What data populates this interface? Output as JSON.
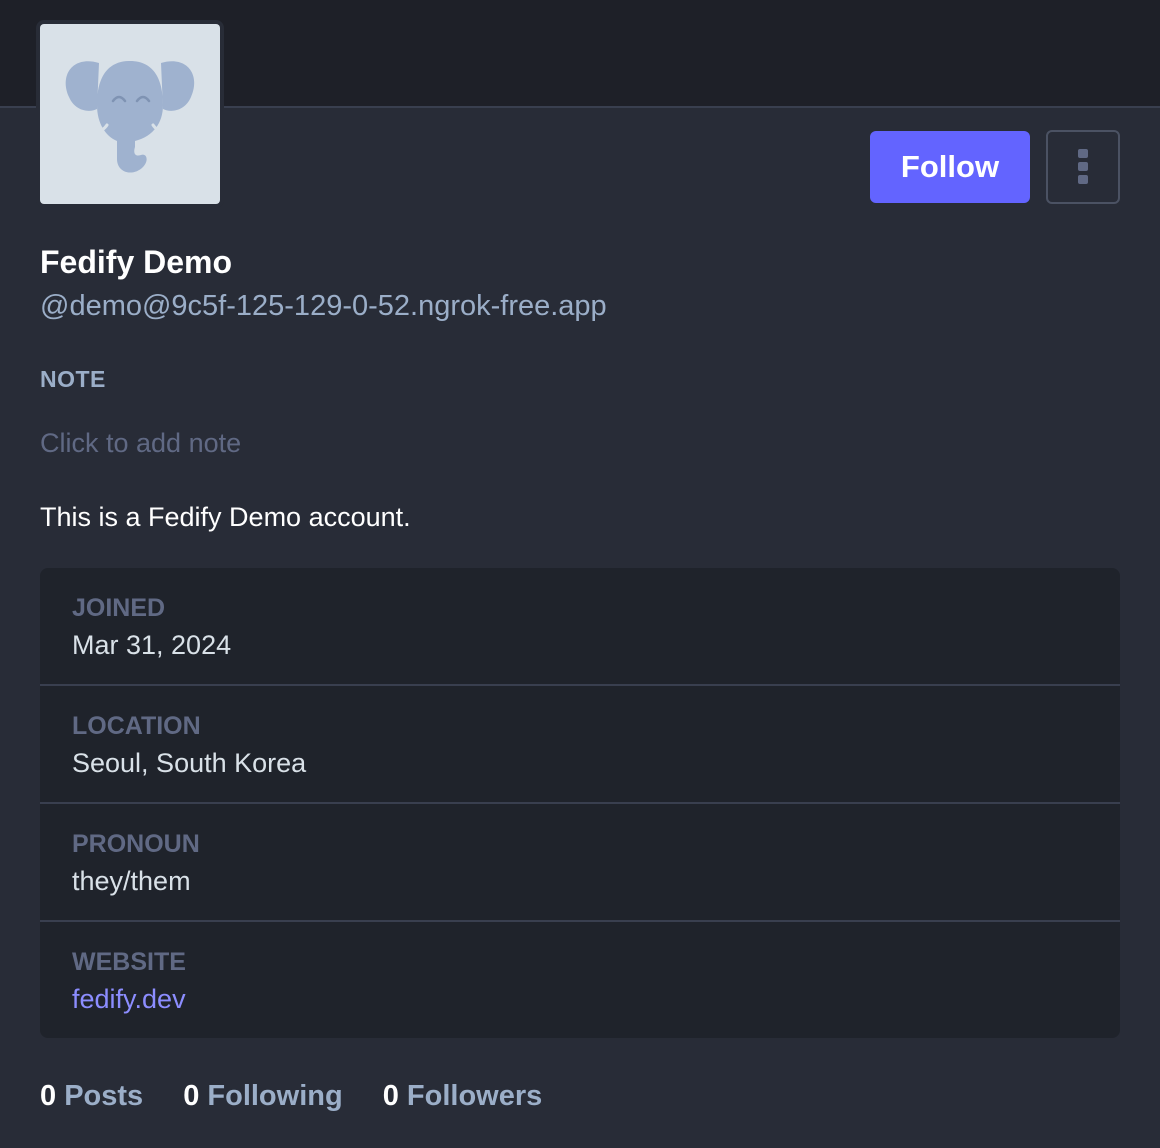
{
  "profile": {
    "display_name": "Fedify Demo",
    "handle": "@demo@9c5f-125-129-0-52.ngrok-free.app",
    "avatar_icon": "elephant-mascot-icon",
    "bio": "This is a Fedify Demo account."
  },
  "actions": {
    "follow_label": "Follow",
    "menu_icon": "vertical-ellipsis-icon"
  },
  "note": {
    "label": "NOTE",
    "placeholder": "Click to add note"
  },
  "fields": [
    {
      "label": "JOINED",
      "value": "Mar 31, 2024"
    },
    {
      "label": "LOCATION",
      "value": "Seoul, South Korea"
    },
    {
      "label": "PRONOUN",
      "value": "they/them"
    },
    {
      "label": "WEBSITE",
      "value": "fedify.dev"
    }
  ],
  "stats": {
    "posts": {
      "count": "0",
      "label": "Posts"
    },
    "following": {
      "count": "0",
      "label": "Following"
    },
    "followers": {
      "count": "0",
      "label": "Followers"
    }
  },
  "colors": {
    "background": "#282c37",
    "banner": "#1e2028",
    "accent": "#6364ff",
    "link": "#8c8dff",
    "muted": "#9baec8"
  }
}
